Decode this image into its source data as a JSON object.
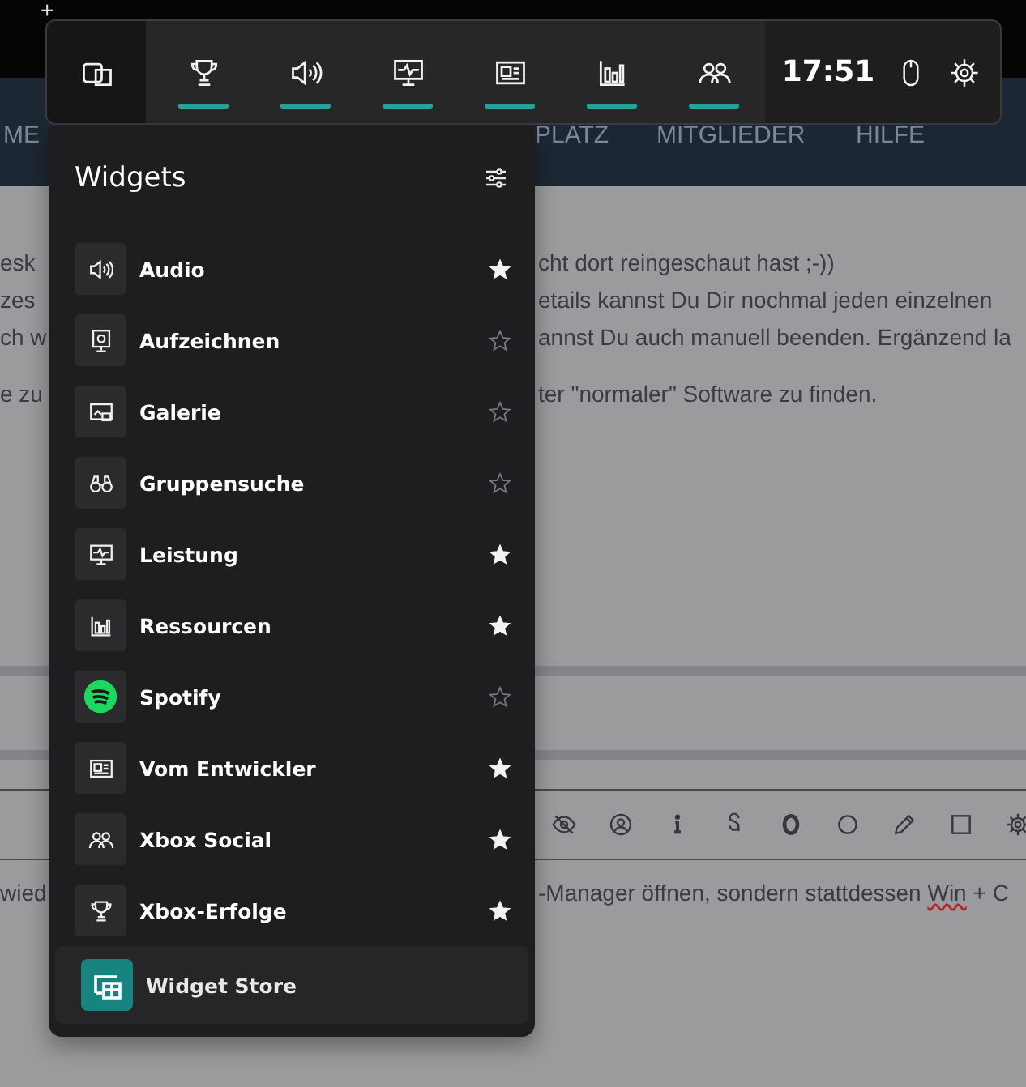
{
  "browser": {
    "new_tab": "+"
  },
  "site_nav": [
    {
      "label": "ME"
    },
    {
      "label": "PLATZ"
    },
    {
      "label": "MITGLIEDER"
    },
    {
      "label": "HILFE"
    }
  ],
  "article_lines": [
    {
      "left": "esk",
      "right": "cht dort reingeschaut hast ;-))"
    },
    {
      "left": "zes",
      "right": "etails kannst Du Dir nochmal jeden einzelnen"
    },
    {
      "left": "ch w",
      "right": "annst Du auch manuell beenden. Ergänzend la"
    },
    {
      "left": "e zu",
      "right": "ter \"normaler\" Software zu finden."
    }
  ],
  "editor": {
    "left": "wied",
    "before": "-Manager öffnen, sondern stattdessen ",
    "misspelled": "Win",
    "after": " + C"
  },
  "game_bar": {
    "widget_menu": {
      "selected": true
    },
    "items": [
      {
        "kind": "trophy",
        "active": true
      },
      {
        "kind": "audio",
        "active": true
      },
      {
        "kind": "performance",
        "active": true
      },
      {
        "kind": "news",
        "active": true
      },
      {
        "kind": "resources",
        "active": true
      },
      {
        "kind": "social",
        "active": true
      }
    ],
    "time": "17:51"
  },
  "widgets_panel": {
    "title": "Widgets",
    "items": [
      {
        "label": "Audio",
        "kind": "audio",
        "favorite": true
      },
      {
        "label": "Aufzeichnen",
        "kind": "record",
        "favorite": false
      },
      {
        "label": "Galerie",
        "kind": "gallery",
        "favorite": false
      },
      {
        "label": "Gruppensuche",
        "kind": "group-search",
        "favorite": false
      },
      {
        "label": "Leistung",
        "kind": "performance",
        "favorite": true
      },
      {
        "label": "Ressourcen",
        "kind": "resources",
        "favorite": true
      },
      {
        "label": "Spotify",
        "kind": "spotify",
        "favorite": false
      },
      {
        "label": "Vom Entwickler",
        "kind": "news",
        "favorite": true
      },
      {
        "label": "Xbox Social",
        "kind": "social",
        "favorite": true
      },
      {
        "label": "Xbox-Erfolge",
        "kind": "trophy",
        "favorite": true
      }
    ],
    "store": {
      "label": "Widget Store"
    }
  }
}
